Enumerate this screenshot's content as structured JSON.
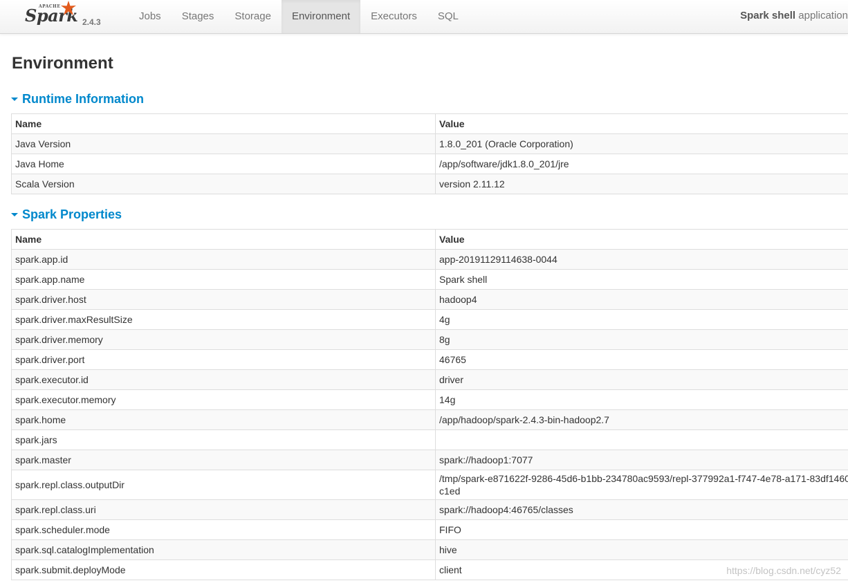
{
  "navbar": {
    "brand_apache": "APACHE",
    "brand_name": "Spark",
    "version": "2.4.3",
    "tabs": [
      {
        "label": "Jobs",
        "active": false
      },
      {
        "label": "Stages",
        "active": false
      },
      {
        "label": "Storage",
        "active": false
      },
      {
        "label": "Environment",
        "active": true
      },
      {
        "label": "Executors",
        "active": false
      },
      {
        "label": "SQL",
        "active": false
      }
    ],
    "app_name": "Spark shell",
    "app_suffix": " application"
  },
  "page": {
    "title": "Environment"
  },
  "runtime": {
    "title": "Runtime Information",
    "headers": [
      "Name",
      "Value"
    ],
    "rows": [
      [
        "Java Version",
        "1.8.0_201 (Oracle Corporation)"
      ],
      [
        "Java Home",
        "/app/software/jdk1.8.0_201/jre"
      ],
      [
        "Scala Version",
        "version 2.11.12"
      ]
    ]
  },
  "spark_properties": {
    "title": "Spark Properties",
    "headers": [
      "Name",
      "Value"
    ],
    "rows": [
      [
        "spark.app.id",
        "app-20191129114638-0044"
      ],
      [
        "spark.app.name",
        "Spark shell"
      ],
      [
        "spark.driver.host",
        "hadoop4"
      ],
      [
        "spark.driver.maxResultSize",
        "4g"
      ],
      [
        "spark.driver.memory",
        "8g"
      ],
      [
        "spark.driver.port",
        "46765"
      ],
      [
        "spark.executor.id",
        "driver"
      ],
      [
        "spark.executor.memory",
        "14g"
      ],
      [
        "spark.home",
        "/app/hadoop/spark-2.4.3-bin-hadoop2.7"
      ],
      [
        "spark.jars",
        ""
      ],
      [
        "spark.master",
        "spark://hadoop1:7077"
      ],
      [
        "spark.repl.class.outputDir",
        "/tmp/spark-e871622f-9286-45d6-b1bb-234780ac9593/repl-377992a1-f747-4e78-a171-83df1460c1ed"
      ],
      [
        "spark.repl.class.uri",
        "spark://hadoop4:46765/classes"
      ],
      [
        "spark.scheduler.mode",
        "FIFO"
      ],
      [
        "spark.sql.catalogImplementation",
        "hive"
      ],
      [
        "spark.submit.deployMode",
        "client"
      ]
    ]
  },
  "watermark": "https://blog.csdn.net/cyz52",
  "colors": {
    "accent": "#0088cc",
    "navbar_active": "#e5e5e5",
    "stripe": "#f9f9f9",
    "border": "#dddddd",
    "logo_star": "#e25a1c"
  },
  "icons": {
    "section_toggle": "caret-down-icon",
    "logo_star": "spark-star-icon"
  }
}
